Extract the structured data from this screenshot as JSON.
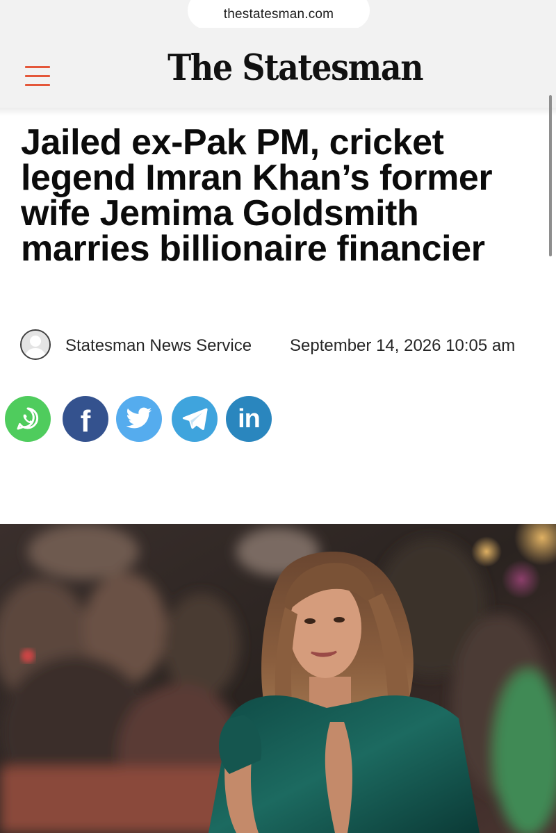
{
  "browser": {
    "url": "thestatesman.com"
  },
  "header": {
    "menu_icon": "hamburger-menu-icon",
    "logo_text": "The Statesman"
  },
  "article": {
    "headline": "Jailed ex-Pak PM, cricket legend Imran Khan’s former wife Jemima Goldsmith marries billionaire financier",
    "author": "Statesman News Service",
    "date": "September 14, 2026 10:05 am"
  },
  "share": [
    {
      "network": "whatsapp",
      "icon": "whatsapp-icon",
      "color": "#4fcc5d"
    },
    {
      "network": "facebook",
      "icon": "facebook-icon",
      "color": "#34528e"
    },
    {
      "network": "twitter",
      "icon": "twitter-icon",
      "color": "#55acee"
    },
    {
      "network": "telegram",
      "icon": "telegram-icon",
      "color": "#3fa4dd"
    },
    {
      "network": "linkedin",
      "icon": "linkedin-icon",
      "color": "#2a86be"
    }
  ],
  "colors": {
    "accent": "#e4573a",
    "header_bg": "#f2f2f2",
    "headline": "#0b0b0b"
  }
}
